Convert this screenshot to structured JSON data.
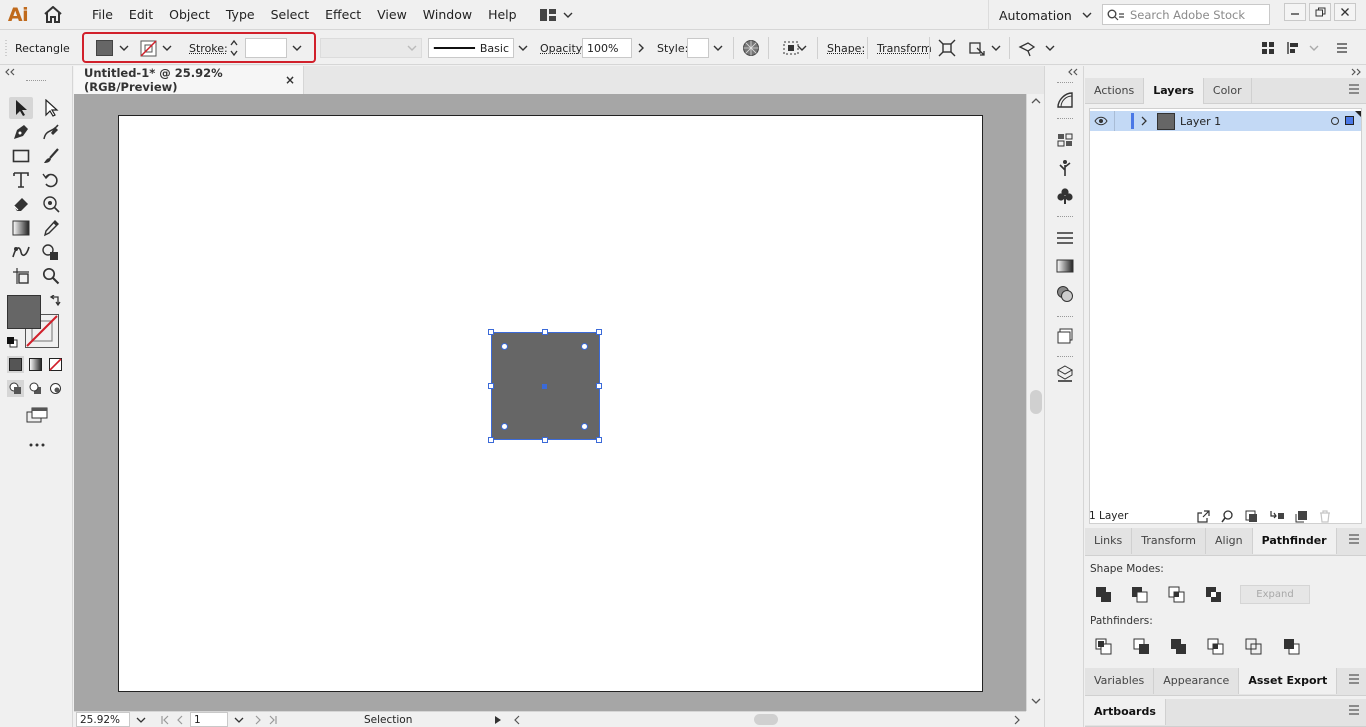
{
  "app": {
    "logo": "Ai"
  },
  "menu": [
    "File",
    "Edit",
    "Object",
    "Type",
    "Select",
    "Effect",
    "View",
    "Window",
    "Help"
  ],
  "topbar": {
    "workspace": "Automation",
    "search_placeholder": "Search Adobe Stock"
  },
  "control": {
    "tool_name": "Rectangle",
    "stroke_label": "Stroke:",
    "stroke_value": "",
    "brush_label": "Basic",
    "opacity_label": "Opacity:",
    "opacity_value": "100%",
    "style_label": "Style:",
    "shape_label": "Shape:",
    "transform_label": "Transform",
    "fill_color": "#666666"
  },
  "document": {
    "tab_title": "Untitled-1* @ 25.92% (RGB/Preview)",
    "close": "×"
  },
  "status": {
    "zoom": "25.92%",
    "artboard_num": "1",
    "tool": "Selection"
  },
  "layers_panel": {
    "tabs": [
      "Actions",
      "Layers",
      "Color"
    ],
    "active_tab": "Layers",
    "rows": [
      {
        "name": "Layer 1"
      }
    ],
    "count": "1 Layer"
  },
  "pathfinder_panel": {
    "tabs": [
      "Links",
      "Transform",
      "Align",
      "Pathfinder"
    ],
    "active_tab": "Pathfinder",
    "shape_modes_label": "Shape Modes:",
    "pathfinders_label": "Pathfinders:",
    "expand_label": "Expand"
  },
  "bottom_panel": {
    "tabs": [
      "Variables",
      "Appearance",
      "Asset Export"
    ],
    "active_tab": "Asset Export"
  },
  "artboards_panel": {
    "tabs": [
      "Artboards"
    ],
    "active_tab": "Artboards"
  },
  "colors": {
    "selection": "#3b6ad8",
    "highlight_box": "#d1202b",
    "logo": "#c06a1c",
    "object_fill": "#666666"
  }
}
